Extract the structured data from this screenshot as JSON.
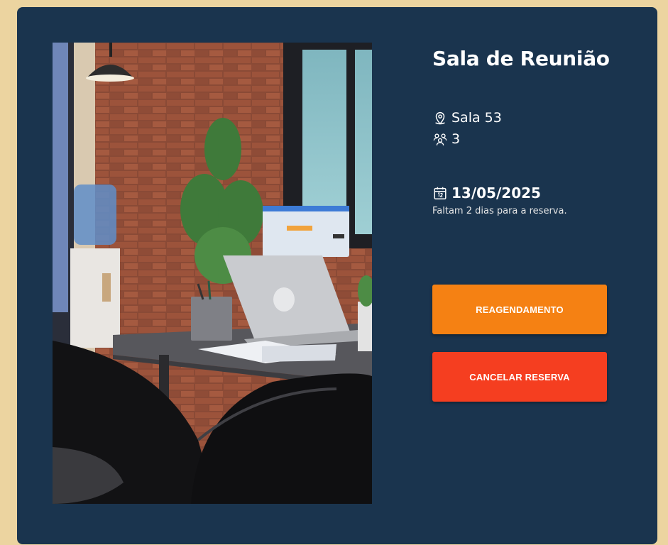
{
  "room": {
    "title": "Sala de Reunião",
    "location": "Sala 53",
    "capacity": "3",
    "date": "13/05/2025",
    "countdown": "Faltam 2 dias para a reserva.",
    "image_alt": "Sala de reunião com mesa, laptop, monitor e plantas"
  },
  "actions": {
    "reschedule_label": "REAGENDAMENTO",
    "cancel_label": "CANCELAR RESERVA"
  },
  "icons": {
    "location": "map-pin-icon",
    "capacity": "users-icon",
    "date": "calendar-icon"
  },
  "colors": {
    "page_background": "#ecd4a0",
    "card_background": "#1a344e",
    "reschedule_button": "#f58113",
    "cancel_button": "#f53e20"
  }
}
